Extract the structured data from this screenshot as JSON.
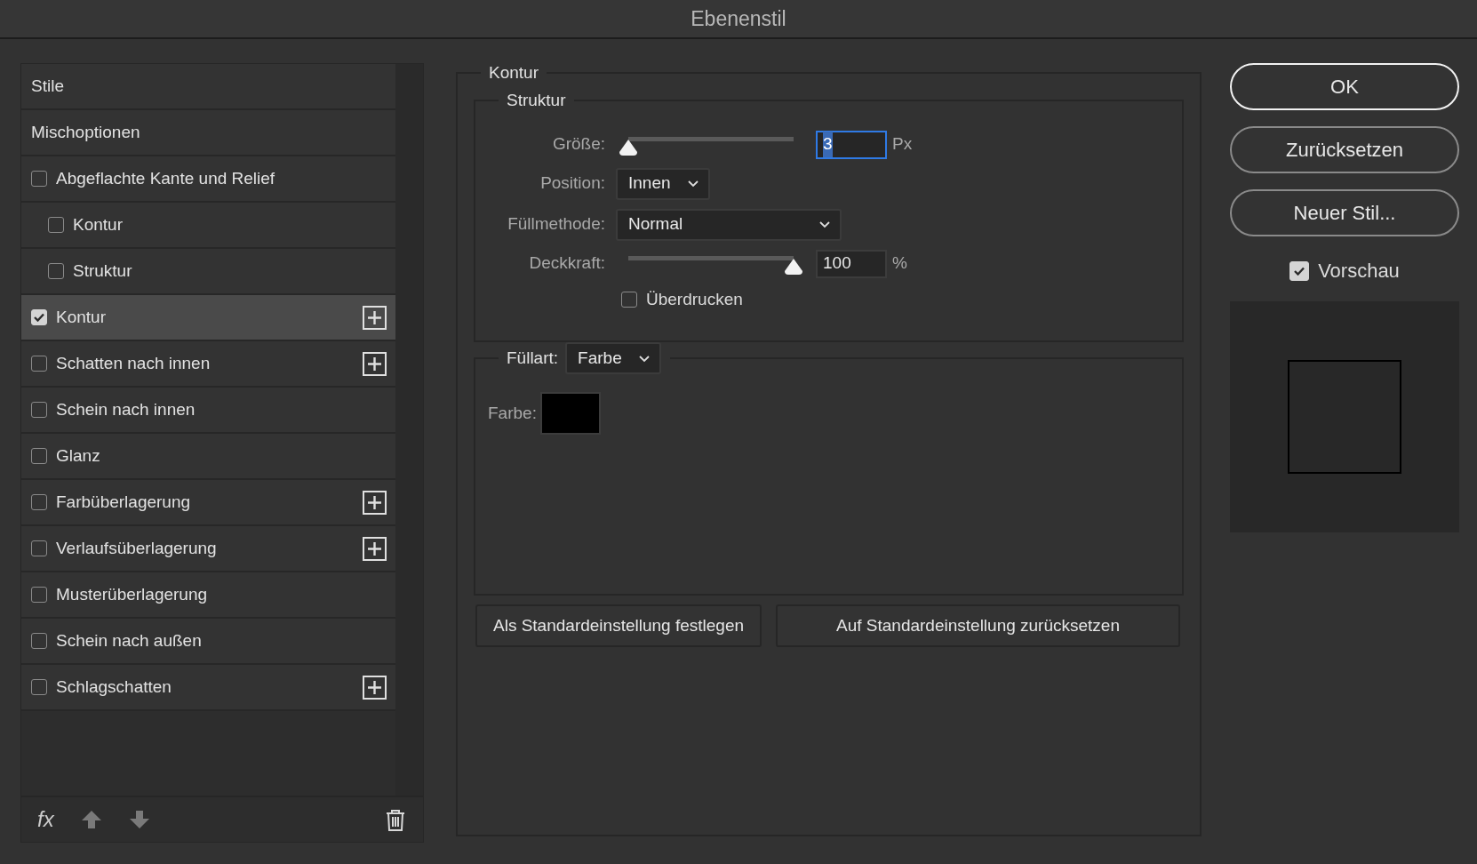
{
  "window": {
    "title": "Ebenenstil"
  },
  "style_list": {
    "items": [
      {
        "label": "Stile",
        "kind": "header",
        "selected": false
      },
      {
        "label": "Mischoptionen",
        "kind": "header",
        "selected": false
      },
      {
        "label": "Abgeflachte Kante und Relief",
        "kind": "checkbox",
        "checked": false,
        "selected": false,
        "addable": false,
        "children": [
          {
            "label": "Kontur",
            "kind": "checkbox",
            "checked": false,
            "selected": false,
            "addable": false
          },
          {
            "label": "Struktur",
            "kind": "checkbox",
            "checked": false,
            "selected": false,
            "addable": false
          }
        ]
      },
      {
        "label": "Kontur",
        "kind": "checkbox",
        "checked": true,
        "selected": true,
        "addable": true
      },
      {
        "label": "Schatten nach innen",
        "kind": "checkbox",
        "checked": false,
        "selected": false,
        "addable": true
      },
      {
        "label": "Schein nach innen",
        "kind": "checkbox",
        "checked": false,
        "selected": false,
        "addable": false
      },
      {
        "label": "Glanz",
        "kind": "checkbox",
        "checked": false,
        "selected": false,
        "addable": false
      },
      {
        "label": "Farbüberlagerung",
        "kind": "checkbox",
        "checked": false,
        "selected": false,
        "addable": true
      },
      {
        "label": "Verlaufsüberlagerung",
        "kind": "checkbox",
        "checked": false,
        "selected": false,
        "addable": true
      },
      {
        "label": "Musterüberlagerung",
        "kind": "checkbox",
        "checked": false,
        "selected": false,
        "addable": false
      },
      {
        "label": "Schein nach außen",
        "kind": "checkbox",
        "checked": false,
        "selected": false,
        "addable": false
      },
      {
        "label": "Schlagschatten",
        "kind": "checkbox",
        "checked": false,
        "selected": false,
        "addable": true
      }
    ],
    "effects_button": {
      "label": "fx"
    }
  },
  "stroke": {
    "title": "Kontur",
    "structure": {
      "title": "Struktur",
      "size": {
        "label": "Größe:",
        "value": "3",
        "unit": "Px",
        "level": 0,
        "focused": true
      },
      "position": {
        "label": "Position:",
        "value": "Innen"
      },
      "blend_mode": {
        "label": "Füllmethode:",
        "value": "Normal"
      },
      "opacity": {
        "label": "Deckkraft:",
        "value": "100",
        "unit": "%",
        "level": 1,
        "focused": false
      },
      "overprint": {
        "label": "Überdrucken",
        "checked": false
      }
    },
    "fill": {
      "label": "Füllart:",
      "value": "Farbe",
      "color_label": "Farbe:",
      "color": "#000000"
    },
    "buttons": [
      "Als Standardeinstellung festlegen",
      "Auf Standardeinstellung zurücksetzen"
    ]
  },
  "actions": [
    {
      "label": "OK",
      "default": true
    },
    {
      "label": "Zurücksetzen",
      "default": false
    },
    {
      "label": "Neuer Stil...",
      "default": false
    }
  ],
  "preview": {
    "label": "Vorschau",
    "checked": true
  }
}
